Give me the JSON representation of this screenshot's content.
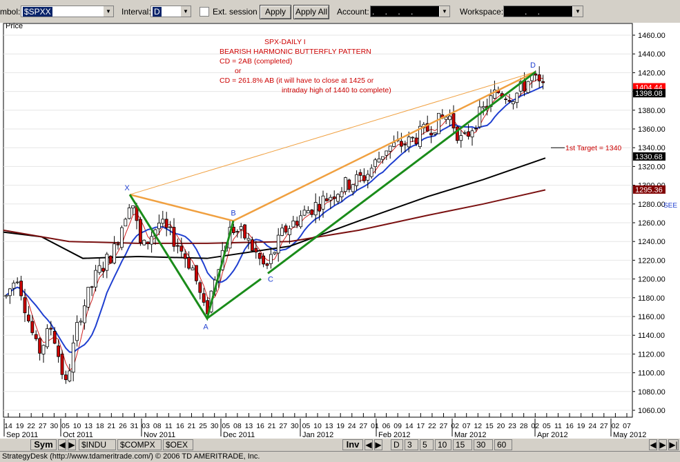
{
  "toolbar": {
    "symbol_label": "mbol:",
    "symbol_value": "$SPXX",
    "interval_label": "Interval:",
    "interval_value": "D",
    "ext_session_label": "Ext. session",
    "apply_label": "Apply",
    "apply_all_label": "Apply All",
    "account_label": "Account:",
    "account_value": ". . . .",
    "workspace_label": "Workspace:",
    "workspace_value": ". ."
  },
  "chart": {
    "price_label": "Price",
    "annotations": [
      "SPX-DAILY  I",
      "BEARISH HARMONIC BUTTERFLY PATTERN",
      "CD = 2AB  (completed)",
      "or",
      "CD = 261.8% AB   (it will have to close at 1425 or",
      "intraday high of 1440 to complete)"
    ],
    "target_label": "1st Target = 1340",
    "see_label": "SEE",
    "point_labels": [
      "X",
      "A",
      "B",
      "C",
      "D"
    ],
    "price_ticks": [
      "1460.00",
      "1440.00",
      "1420.00",
      "1400.00",
      "1380.00",
      "1360.00",
      "1340.00",
      "1320.00",
      "1300.00",
      "1280.00",
      "1260.00",
      "1240.00",
      "1220.00",
      "1200.00",
      "1180.00",
      "1160.00",
      "1140.00",
      "1120.00",
      "1100.00",
      "1080.00",
      "1060.00"
    ],
    "price_badges": [
      {
        "text": "1404.44",
        "bg": "#ff0000",
        "fg": "#ffffff"
      },
      {
        "text": "1398.08",
        "bg": "#000000",
        "fg": "#ffffff"
      },
      {
        "text": "1330.68",
        "bg": "#000000",
        "fg": "#ffffff"
      },
      {
        "text": "1295.36",
        "bg": "#800000",
        "fg": "#ffffff"
      }
    ],
    "day_ticks": [
      "14",
      "19",
      "22",
      "27",
      "30",
      "05",
      "10",
      "13",
      "18",
      "21",
      "26",
      "31",
      "03",
      "08",
      "11",
      "16",
      "21",
      "25",
      "30",
      "05",
      "08",
      "13",
      "16",
      "21",
      "27",
      "30",
      "05",
      "10",
      "13",
      "19",
      "24",
      "27",
      "01",
      "06",
      "09",
      "14",
      "17",
      "22",
      "27",
      "02",
      "07",
      "12",
      "15",
      "20",
      "23",
      "28",
      "02",
      "05",
      "11",
      "16",
      "19",
      "24",
      "27",
      "02",
      "07"
    ],
    "month_ticks": [
      "Sep 2011",
      "Oct 2011",
      "Nov 2011",
      "Dec 2011",
      "Jan 2012",
      "Feb 2012",
      "Mar 2012",
      "Apr 2012",
      "May 2012"
    ],
    "colors": {
      "bull": "#ffffff",
      "bear": "#cc0000",
      "pattern_green": "#1a8c1a",
      "pattern_orange": "#f0a040",
      "ma_blue": "#1f3fd0",
      "ma_red": "#d02020",
      "ma_black": "#000000",
      "ma_maroon": "#7a1010",
      "annotation": "#cc0000"
    }
  },
  "bottom": {
    "sym_label": "Sym",
    "symbol_tabs": [
      "$INDU",
      "$COMPX",
      "$OEX"
    ],
    "inv_label": "Inv",
    "interval_tabs": [
      "D",
      "3",
      "5",
      "10",
      "15",
      "30",
      "60"
    ]
  },
  "status": {
    "text": "StrategyDesk (http://www.tdameritrade.com/) © 2006 TD AMERITRADE, Inc."
  }
}
